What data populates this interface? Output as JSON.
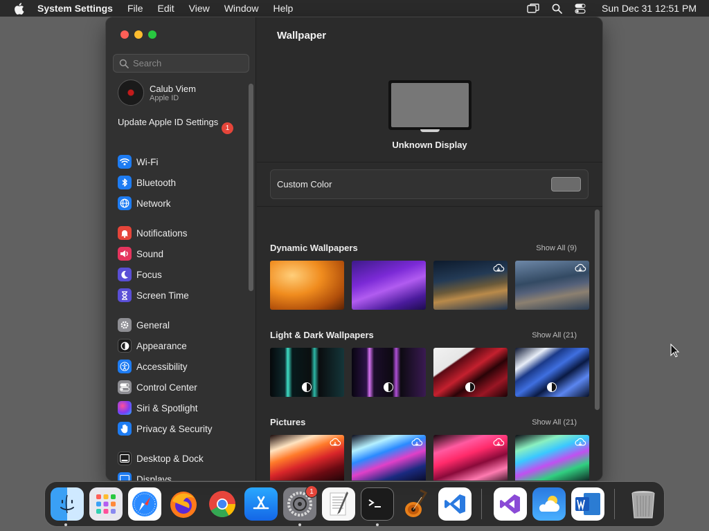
{
  "menubar": {
    "app_name": "System Settings",
    "menus": [
      "File",
      "Edit",
      "View",
      "Window",
      "Help"
    ],
    "clock": "Sun Dec 31  12:51 PM"
  },
  "sidebar": {
    "search_placeholder": "Search",
    "profile": {
      "name": "Calub Viem",
      "subtitle": "Apple ID"
    },
    "update": {
      "label": "Update Apple ID Settings",
      "badge": "1"
    },
    "items": [
      {
        "label": "Wi-Fi",
        "icon": "wifi-icon",
        "color": "#1e7cf2"
      },
      {
        "label": "Bluetooth",
        "icon": "bluetooth-icon",
        "color": "#1e7cf2"
      },
      {
        "label": "Network",
        "icon": "globe-icon",
        "color": "#1e7cf2"
      },
      {
        "label": "Notifications",
        "icon": "bell-icon",
        "color": "#e5453a"
      },
      {
        "label": "Sound",
        "icon": "speaker-icon",
        "color": "#e5355e"
      },
      {
        "label": "Focus",
        "icon": "moon-icon",
        "color": "#5a4fd6"
      },
      {
        "label": "Screen Time",
        "icon": "hourglass-icon",
        "color": "#5a4fd6"
      },
      {
        "label": "General",
        "icon": "gear-icon",
        "color": "#8e8e93"
      },
      {
        "label": "Appearance",
        "icon": "appearance-icon",
        "color": "#1c1c1c"
      },
      {
        "label": "Accessibility",
        "icon": "accessibility-icon",
        "color": "#1e7cf2"
      },
      {
        "label": "Control Center",
        "icon": "toggles-icon",
        "color": "#8e8e93"
      },
      {
        "label": "Siri & Spotlight",
        "icon": "siri-icon",
        "color": "#b43ad1"
      },
      {
        "label": "Privacy & Security",
        "icon": "hand-icon",
        "color": "#1e7cf2"
      },
      {
        "label": "Desktop & Dock",
        "icon": "dock-icon",
        "color": "#1c1c1c"
      },
      {
        "label": "Displays",
        "icon": "display-icon",
        "color": "#1e7cf2"
      }
    ]
  },
  "main": {
    "title": "Wallpaper",
    "display_label": "Unknown Display",
    "custom_color_label": "Custom Color",
    "custom_color_value": "#6b6b6b",
    "sections": [
      {
        "title": "Dynamic Wallpapers",
        "show_all": "Show All (9)"
      },
      {
        "title": "Light & Dark Wallpapers",
        "show_all": "Show All (21)"
      },
      {
        "title": "Pictures",
        "show_all": "Show All (21)"
      }
    ]
  },
  "dock": {
    "apps": [
      "Finder",
      "Launchpad",
      "Safari",
      "Firefox",
      "Chrome",
      "App Store",
      "System Settings",
      "TextEdit",
      "Terminal",
      "GarageBand",
      "Visual Studio Code",
      "Visual Studio",
      "Weather",
      "Microsoft Word",
      "Trash"
    ],
    "settings_badge": "1"
  }
}
